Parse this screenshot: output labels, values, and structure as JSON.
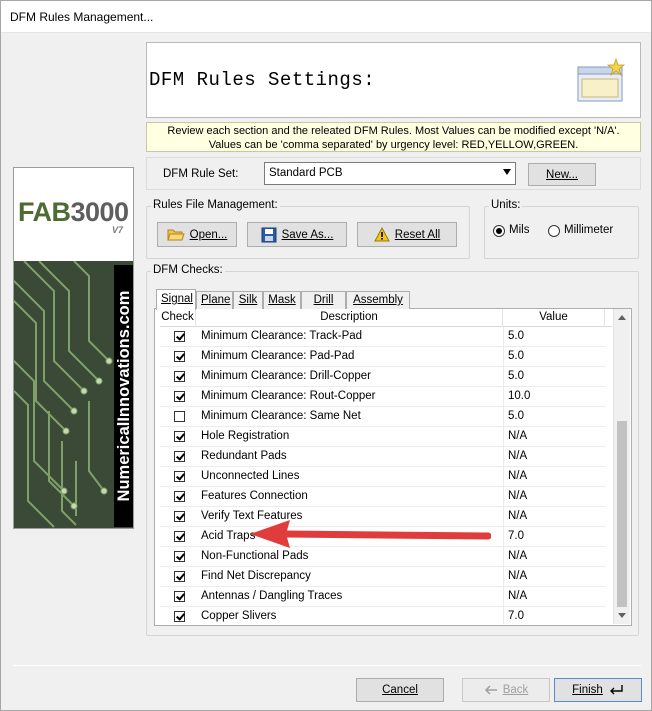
{
  "window": {
    "title": "DFM Rules Management..."
  },
  "header": {
    "title": "DFM Rules Settings:"
  },
  "notice": {
    "line1": "Review each section and the releated DFM Rules. Most Values can be modified except 'N/A'.",
    "line2": "Values can be 'comma separated' by urgency level: RED,YELLOW,GREEN."
  },
  "branding": {
    "product_logo": "FAB3000",
    "product_version": "V7",
    "vendor": "NumericalInnovations.com"
  },
  "ruleset": {
    "label": "DFM Rule Set:",
    "selected": "Standard PCB",
    "new_button": "New..."
  },
  "rules_file": {
    "group_label": "Rules File Management:",
    "open_button": "Open...",
    "save_as_button": "Save As...",
    "reset_all_button": "Reset All"
  },
  "units": {
    "group_label": "Units:",
    "options": [
      "Mils",
      "Millimeter"
    ],
    "selected": "Mils"
  },
  "dfm_checks": {
    "group_label": "DFM Checks:",
    "tabs": [
      "Signal",
      "Plane",
      "Silk",
      "Mask",
      "Drill",
      "Assembly"
    ],
    "active_tab": "Signal",
    "columns": [
      "Check",
      "Description",
      "Value"
    ],
    "rows": [
      {
        "checked": true,
        "description": "Minimum Clearance: Track-Pad",
        "value": "5.0"
      },
      {
        "checked": true,
        "description": "Minimum Clearance: Pad-Pad",
        "value": "5.0"
      },
      {
        "checked": true,
        "description": "Minimum Clearance: Drill-Copper",
        "value": "5.0"
      },
      {
        "checked": true,
        "description": "Minimum Clearance: Rout-Copper",
        "value": "10.0"
      },
      {
        "checked": false,
        "description": "Minimum Clearance: Same Net",
        "value": "5.0"
      },
      {
        "checked": true,
        "description": "Hole Registration",
        "value": "N/A"
      },
      {
        "checked": true,
        "description": "Redundant Pads",
        "value": "N/A"
      },
      {
        "checked": true,
        "description": "Unconnected Lines",
        "value": "N/A"
      },
      {
        "checked": true,
        "description": "Features Connection",
        "value": "N/A"
      },
      {
        "checked": true,
        "description": "Verify Text Features",
        "value": "N/A"
      },
      {
        "checked": true,
        "description": "Acid Traps",
        "value": "7.0"
      },
      {
        "checked": true,
        "description": "Non-Functional Pads",
        "value": "N/A"
      },
      {
        "checked": true,
        "description": "Find Net Discrepancy",
        "value": "N/A"
      },
      {
        "checked": true,
        "description": "Antennas / Dangling Traces",
        "value": "N/A"
      },
      {
        "checked": true,
        "description": "Copper Slivers",
        "value": "7.0"
      }
    ]
  },
  "footer": {
    "cancel_button": "Cancel",
    "back_button": "Back",
    "finish_button": "Finish"
  },
  "colors": {
    "annotation_arrow": "#e03c3c",
    "notice_background": "#ffffe1",
    "logo_green": "#4d6b33"
  }
}
